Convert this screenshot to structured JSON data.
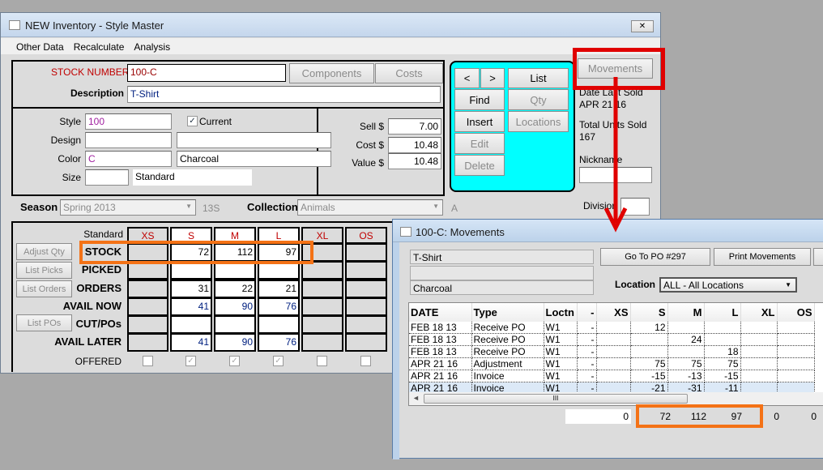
{
  "main": {
    "title": "NEW Inventory - Style Master",
    "close": "✕",
    "menu": [
      "Other Data",
      "Recalculate",
      "Analysis"
    ],
    "stock_number_label": "STOCK NUMBER",
    "stock_number": "100-C",
    "components": "Components",
    "costs": "Costs",
    "description_label": "Description",
    "description": "T-Shirt",
    "style_label": "Style",
    "style": "100",
    "current_label": "Current",
    "current_checked": true,
    "design_label": "Design",
    "design": "",
    "design2": "",
    "color_label": "Color",
    "color": "C",
    "color_name": "Charcoal",
    "size_label": "Size",
    "size": "",
    "size_name": "Standard",
    "sell_label": "Sell $",
    "sell": "7.00",
    "cost_label": "Cost $",
    "cost": "10.48",
    "value_label": "Value $",
    "value": "10.48",
    "nav": {
      "prev": "<",
      "next": ">",
      "find": "Find",
      "insert": "Insert",
      "edit": "Edit",
      "delete": "Delete",
      "list": "List",
      "qty": "Qty",
      "locations": "Locations"
    },
    "movements": "Movements",
    "date_last_sold_label": "Date Last Sold",
    "date_last_sold": "APR 21 16",
    "total_units_label": "Total Units Sold",
    "total_units": "167",
    "nickname_label": "Nickname",
    "nickname": "",
    "division_label": "Division",
    "division": "",
    "season_label": "Season",
    "season": "Spring 2013",
    "season_code": "13S",
    "collection_label": "Collection",
    "collection": "Animals",
    "collection_code": "A",
    "grid": {
      "scale_label": "Standard",
      "sizes": [
        "XS",
        "S",
        "M",
        "L",
        "XL",
        "OS"
      ],
      "rows": [
        {
          "label": "STOCK",
          "values": [
            "",
            "72",
            "112",
            "97",
            "",
            ""
          ]
        },
        {
          "label": "PICKED",
          "values": [
            "",
            "",
            "",
            "",
            "",
            ""
          ]
        },
        {
          "label": "ORDERS",
          "values": [
            "",
            "31",
            "22",
            "21",
            "",
            ""
          ]
        },
        {
          "label": "AVAIL NOW",
          "values": [
            "",
            "41",
            "90",
            "76",
            "",
            ""
          ]
        },
        {
          "label": "CUT/POs",
          "values": [
            "",
            "",
            "",
            "",
            "",
            ""
          ]
        },
        {
          "label": "AVAIL LATER",
          "values": [
            "",
            "41",
            "90",
            "76",
            "",
            ""
          ]
        }
      ],
      "offered_label": "OFFERED",
      "offered": [
        false,
        true,
        true,
        true,
        false,
        false
      ]
    },
    "buttons": {
      "adjust_qty": "Adjust Qty",
      "list_picks": "List Picks",
      "list_orders": "List Orders",
      "list_pos": "List POs"
    }
  },
  "movements_win": {
    "title": "100-C: Movements",
    "description": "T-Shirt",
    "line2": "",
    "color": "Charcoal",
    "goto_po": "Go To PO #297",
    "print": "Print Movements",
    "location_label": "Location",
    "location": "ALL - All Locations",
    "columns": [
      "DATE",
      "Type",
      "Loctn",
      "-",
      "XS",
      "S",
      "M",
      "L",
      "XL",
      "OS"
    ],
    "rows": [
      [
        "FEB 18 13",
        "Receive PO",
        "W1",
        "-",
        "",
        "12",
        "",
        "",
        "",
        ""
      ],
      [
        "FEB 18 13",
        "Receive PO",
        "W1",
        "-",
        "",
        "",
        "24",
        "",
        "",
        ""
      ],
      [
        "FEB 18 13",
        "Receive PO",
        "W1",
        "-",
        "",
        "",
        "",
        "18",
        "",
        ""
      ],
      [
        "APR 21 16",
        "Adjustment",
        "W1",
        "-",
        "",
        "75",
        "75",
        "75",
        "",
        ""
      ],
      [
        "APR 21 16",
        "Invoice",
        "W1",
        "-",
        "",
        "-15",
        "-13",
        "-15",
        "",
        ""
      ],
      [
        "APR 21 16",
        "Invoice",
        "W1",
        "-",
        "",
        "-21",
        "-31",
        "-11",
        "",
        ""
      ]
    ],
    "selected_row": 5,
    "totals": [
      "0",
      "72",
      "112",
      "97",
      "0",
      "0"
    ],
    "scroll_grip": "III"
  },
  "colors": {
    "highlight_red": "#e00000",
    "highlight_orange": "#f47216",
    "nav_panel": "#00ffff"
  }
}
